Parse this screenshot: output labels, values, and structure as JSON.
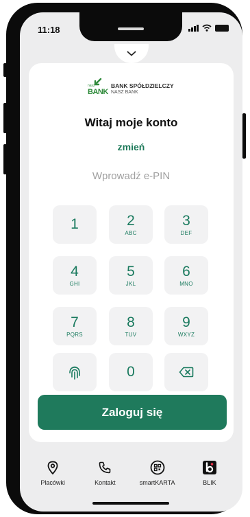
{
  "status_bar": {
    "time": "11:18"
  },
  "brand": {
    "logo_small": "nasz",
    "logo_big": "BANK",
    "name": "BANK SPÓŁDZIELCZY",
    "subname": "NASZ BANK",
    "accent_color": "#1f7a5c"
  },
  "login": {
    "greeting": "Witaj moje konto",
    "change_link": "zmień",
    "pin_label": "Wprowadź e-PIN",
    "submit_label": "Zaloguj się"
  },
  "keypad": {
    "keys": [
      {
        "digit": "1",
        "letters": ""
      },
      {
        "digit": "2",
        "letters": "ABC"
      },
      {
        "digit": "3",
        "letters": "DEF"
      },
      {
        "digit": "4",
        "letters": "GHI"
      },
      {
        "digit": "5",
        "letters": "JKL"
      },
      {
        "digit": "6",
        "letters": "MNO"
      },
      {
        "digit": "7",
        "letters": "PQRS"
      },
      {
        "digit": "8",
        "letters": "TUV"
      },
      {
        "digit": "9",
        "letters": "WXYZ"
      },
      {
        "digit": "0",
        "letters": ""
      }
    ],
    "fingerprint_icon": "fingerprint-icon",
    "backspace_icon": "backspace-icon"
  },
  "tabbar": {
    "items": [
      {
        "label": "Placówki",
        "icon": "location-pin-icon"
      },
      {
        "label": "Kontakt",
        "icon": "phone-icon"
      },
      {
        "label": "smartKARTA",
        "icon": "card-qr-icon"
      },
      {
        "label": "BLIK",
        "icon": "blik-icon"
      }
    ]
  }
}
